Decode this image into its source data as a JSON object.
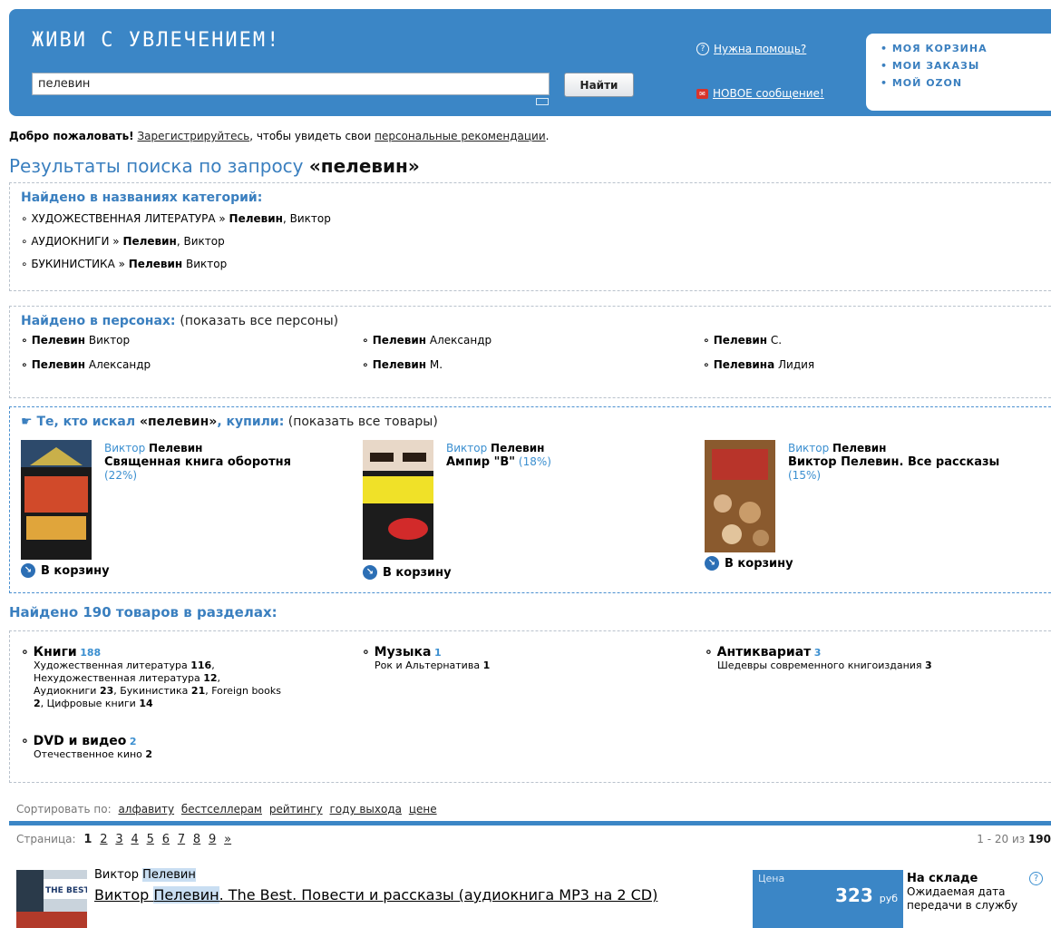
{
  "header": {
    "logo": "ЖИВИ С УВЛЕЧЕНИЕМ!",
    "search_value": "пелевин",
    "search_button": "Найти",
    "help_link": "Нужна помощь?",
    "message_link": "НОВОЕ сообщение!",
    "user_menu": [
      "• МОЯ КОРЗИНА",
      "• МОИ ЗАКАЗЫ",
      "• МОЙ OZON"
    ]
  },
  "welcome": {
    "bold": "Добро пожаловать!",
    "register_link": "Зарегистрируйтесь",
    "middle": ", чтобы увидеть свои ",
    "recs_link": "персональные рекомендации",
    "end": "."
  },
  "results": {
    "prefix": "Результаты поиска по запросу ",
    "query": "«пелевин»"
  },
  "categories": {
    "title": "Найдено в названиях категорий:",
    "items": [
      {
        "path": "∘ ХУДОЖЕСТВЕННАЯ ЛИТЕРАТУРА » ",
        "bold": "Пелевин",
        "rest": ", Виктор"
      },
      {
        "path": "∘ АУДИОКНИГИ » ",
        "bold": "Пелевин",
        "rest": ", Виктор"
      },
      {
        "path": "∘ БУКИНИСТИКА » ",
        "bold": "Пелевин",
        "rest": " Виктор"
      }
    ]
  },
  "persons": {
    "title": "Найдено в персонах:",
    "show_all": "(показать все персоны)",
    "items": [
      {
        "bold": "∘ Пелевин",
        "rest": " Виктор"
      },
      {
        "bold": "∘ Пелевин",
        "rest": " Александр"
      },
      {
        "bold": "∘ Пелевин",
        "rest": " С."
      },
      {
        "bold": "∘ Пелевин",
        "rest": " Александр"
      },
      {
        "bold": "∘ Пелевин",
        "rest": " М."
      },
      {
        "bold": "∘ Пелевина",
        "rest": " Лидия"
      }
    ]
  },
  "bought": {
    "title_a": "Те, кто искал ",
    "title_query": "«пелевин»",
    "title_b": ", купили:",
    "show_all": " (показать все товары)",
    "products": [
      {
        "author_first": "Виктор ",
        "author_last": "Пелевин",
        "title": "Священная книга оборотня",
        "pct": "(22%)",
        "cart": "В корзину"
      },
      {
        "author_first": "Виктор ",
        "author_last": "Пелевин",
        "title": "Ампир \"В\"",
        "pct": "(18%)",
        "cart": "В корзину"
      },
      {
        "author_first": "Виктор ",
        "author_last": "Пелевин",
        "title": "Виктор Пелевин. Все рассказы",
        "pct": "(15%)",
        "cart": "В корзину"
      }
    ]
  },
  "sections": {
    "title": "Найдено 190 товаров в разделах:",
    "books": {
      "name": "∘ Книги",
      "count": "188",
      "l1": "Художественная литература ",
      "c1": "116",
      "l2": "Нехудожественная литература ",
      "c2": "12",
      "l3": "Аудиокниги ",
      "c3": "23",
      "l4": ", Букинистика ",
      "c4": "21",
      "l5": ", Foreign books",
      "c5": "2",
      "l6": ", Цифровые книги ",
      "c6": "14"
    },
    "music": {
      "name": "∘ Музыка",
      "count": "1",
      "l1": "Рок и Альтернатива ",
      "c1": "1"
    },
    "antique": {
      "name": "∘ Антиквариат",
      "count": "3",
      "l1": "Шедевры современного книгоиздания ",
      "c1": "3"
    },
    "dvd": {
      "name": "∘ DVD и видео",
      "count": "2",
      "l1": "Отечественное кино ",
      "c1": "2"
    }
  },
  "sort": {
    "label": "Сортировать по:",
    "options": [
      "алфавиту",
      "бестселлерам",
      "рейтингу",
      "году выхода",
      "цене"
    ]
  },
  "pager": {
    "label": "Страница:",
    "pages": [
      "1",
      "2",
      "3",
      "4",
      "5",
      "6",
      "7",
      "8",
      "9",
      "»"
    ],
    "range": "1 - 20 из ",
    "total": "190"
  },
  "listing": {
    "author_first": "Виктор ",
    "author_last": "Пелевин",
    "title_a": "Виктор ",
    "title_hl": "Пелевин",
    "title_b": ". The Best. Повести и рассказы (аудиокнига MP3 на 2 CD)",
    "thumb_text": "THE BEST",
    "price_label": "Цена",
    "price": "323",
    "currency": "руб",
    "stock": "На складе",
    "stock_note": "Ожидаемая дата передачи в службу"
  }
}
